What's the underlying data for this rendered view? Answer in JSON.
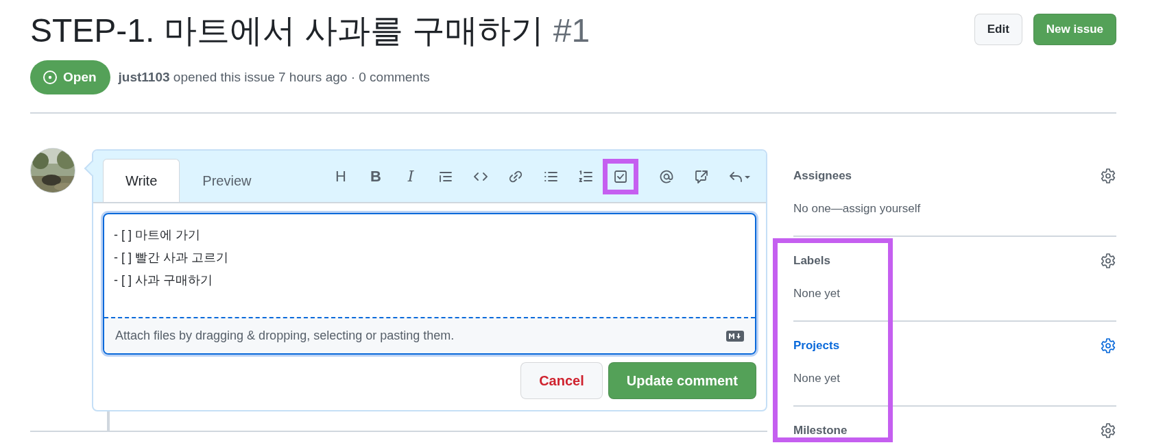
{
  "issue": {
    "title": "STEP-1. 마트에서 사과를 구매하기",
    "number": "#1"
  },
  "header_buttons": [
    {
      "label": "Edit",
      "kind": "default"
    },
    {
      "label": "New issue",
      "kind": "primary"
    }
  ],
  "status": {
    "label": "Open"
  },
  "meta": {
    "author": "just1103",
    "text": "opened this issue 7 hours ago · 0 comments"
  },
  "editor": {
    "tabs": [
      {
        "label": "Write",
        "selected": true
      },
      {
        "label": "Preview",
        "selected": false
      }
    ],
    "tools": [
      {
        "kind": "heading",
        "glyph": "H",
        "highlighted": false
      },
      {
        "kind": "bold",
        "glyph": "B",
        "highlighted": false
      },
      {
        "kind": "italic",
        "glyph": "I",
        "highlighted": false
      },
      {
        "kind": "quote",
        "highlighted": false
      },
      {
        "kind": "code",
        "highlighted": false
      },
      {
        "kind": "link",
        "highlighted": false
      },
      {
        "kind": "bullets",
        "highlighted": false
      },
      {
        "kind": "numbers",
        "highlighted": false
      },
      {
        "kind": "tasklist",
        "highlighted": true
      },
      {
        "kind": "mention",
        "highlighted": false
      },
      {
        "kind": "reference",
        "highlighted": false
      },
      {
        "kind": "reply",
        "highlighted": false
      }
    ],
    "lines": [
      "- [ ] 마트에 가기",
      "- [ ] 빨간 사과 고르기",
      "- [ ] 사과 구매하기"
    ],
    "attach_hint": "Attach files by dragging & dropping, selecting or pasting them.",
    "buttons": [
      {
        "label": "Cancel",
        "kind": "danger"
      },
      {
        "label": "Update comment",
        "kind": "primary"
      }
    ]
  },
  "sidebar": {
    "sections": [
      {
        "heading": "Assignees",
        "value": "No one—assign yourself",
        "hovered": false,
        "highlighted": false
      },
      {
        "heading": "Labels",
        "value": "None yet",
        "hovered": false,
        "highlighted": true
      },
      {
        "heading": "Projects",
        "value": "None yet",
        "hovered": true,
        "highlighted": true
      },
      {
        "heading": "Milestone",
        "hovered": false,
        "highlighted": true
      }
    ]
  }
}
